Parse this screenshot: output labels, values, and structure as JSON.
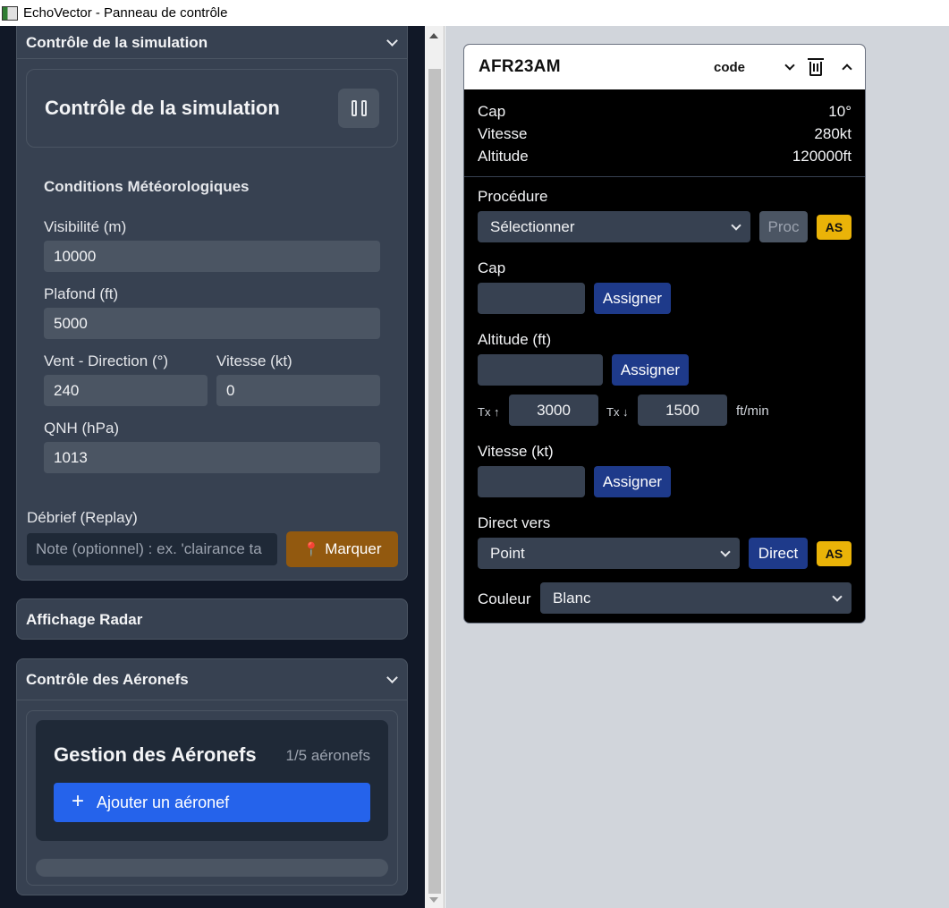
{
  "window": {
    "title": "EchoVector - Panneau de contrôle"
  },
  "sim_section": {
    "header": "Contrôle de la simulation",
    "card_title": "Contrôle de la simulation",
    "weather_title": "Conditions Météorologiques",
    "visibility_label": "Visibilité (m)",
    "visibility_value": "10000",
    "ceiling_label": "Plafond (ft)",
    "ceiling_value": "5000",
    "wind_dir_label": "Vent - Direction (°)",
    "wind_dir_value": "240",
    "wind_speed_label": "Vitesse (kt)",
    "wind_speed_value": "0",
    "qnh_label": "QNH (hPa)",
    "qnh_value": "1013",
    "debrief_label": "Débrief (Replay)",
    "note_placeholder": "Note (optionnel) : ex. 'clairance ta",
    "mark_label": "Marquer"
  },
  "radar_section": {
    "header": "Affichage Radar"
  },
  "aircraft_section": {
    "header": "Contrôle des Aéronefs",
    "gestion_title": "Gestion des Aéronefs",
    "count": "1/5 aéronefs",
    "add_label": "Ajouter un aéronef"
  },
  "aircraft_panel": {
    "callsign": "AFR23AM",
    "code_label": "code",
    "info": {
      "cap_label": "Cap",
      "cap_value": "10°",
      "speed_label": "Vitesse",
      "speed_value": "280kt",
      "alt_label": "Altitude",
      "alt_value": "120000ft"
    },
    "procedure_label": "Procédure",
    "procedure_select": "Sélectionner",
    "proc_button": "Proc",
    "as_badge": "AS",
    "cap_label": "Cap",
    "assign_label": "Assigner",
    "altitude_label": "Altitude (ft)",
    "tx_up_label": "Tx ↑",
    "tx_up_value": "3000",
    "tx_down_label": "Tx ↓",
    "tx_down_value": "1500",
    "rate_unit": "ft/min",
    "speed_label": "Vitesse (kt)",
    "direct_label": "Direct vers",
    "point_select": "Point",
    "direct_button": "Direct",
    "color_label": "Couleur",
    "color_select": "Blanc"
  },
  "colors": {
    "sidebar_bg": "#111827",
    "section_bg": "#374151",
    "add_button": "#2563eb",
    "mark_button": "#92590f",
    "assign_button": "#1e3a8a",
    "as_badge": "#eab308"
  }
}
